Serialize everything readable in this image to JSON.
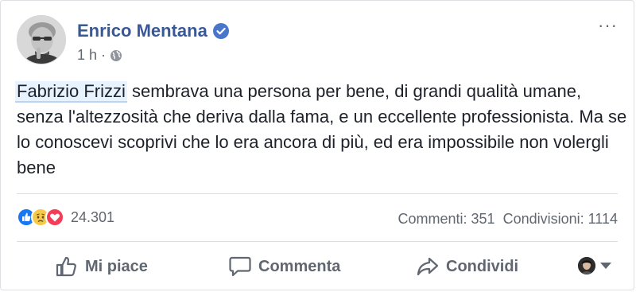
{
  "author": {
    "name": "Enrico Mentana",
    "verified": true
  },
  "meta": {
    "time": "1 h",
    "separator": "·",
    "audience_icon": "globe-icon"
  },
  "more_label": "···",
  "post": {
    "mention": "Fabrizio Frizzi",
    "text": " sembrava una persona per bene, di grandi qualità umane, senza l'altezzosità che deriva dalla fama, e un eccellente professionista. Ma se lo conoscevi scoprivi che lo era ancora di più, ed era impossibile non volergli bene"
  },
  "reactions": {
    "icons": [
      "like-reaction-icon",
      "sad-reaction-icon",
      "love-reaction-icon"
    ],
    "count": "24.301"
  },
  "counts": {
    "comments": "Commenti: 351",
    "shares": "Condivisioni: 1114"
  },
  "actions": {
    "like": "Mi piace",
    "comment": "Commenta",
    "share": "Condividi"
  },
  "colors": {
    "brand_blue": "#385898",
    "like_blue": "#1877f2",
    "love_red": "#f33e58",
    "sad_yellow": "#f7c948",
    "meta_gray": "#606770"
  }
}
